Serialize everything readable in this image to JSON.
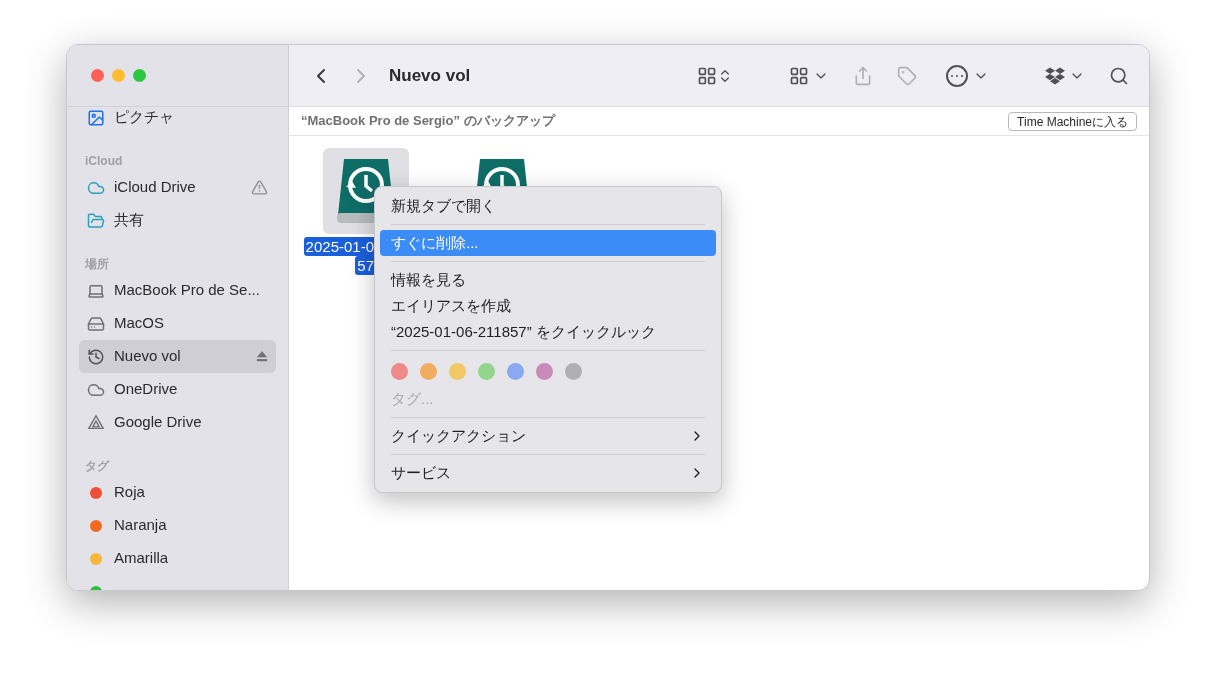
{
  "toolbar": {
    "title": "Nuevo vol",
    "back_disabled": false,
    "forward_disabled": true
  },
  "sidebar": {
    "sections": [
      {
        "items": [
          {
            "label": "ピクチャ",
            "kind": "pictures",
            "selected": false
          }
        ]
      },
      {
        "header": "iCloud",
        "items": [
          {
            "label": "iCloud Drive",
            "kind": "cloud",
            "selected": false,
            "warning": true
          },
          {
            "label": "共有",
            "kind": "shared",
            "selected": false
          }
        ]
      },
      {
        "header": "場所",
        "items": [
          {
            "label": "MacBook Pro de Se...",
            "kind": "laptop",
            "selected": false
          },
          {
            "label": "MacOS",
            "kind": "drive",
            "selected": false
          },
          {
            "label": "Nuevo vol",
            "kind": "volume",
            "selected": true,
            "eject": true
          },
          {
            "label": "OneDrive",
            "kind": "onedrive",
            "selected": false
          },
          {
            "label": "Google Drive",
            "kind": "gdrive",
            "selected": false
          }
        ]
      },
      {
        "header": "タグ",
        "items": [
          {
            "label": "Roja",
            "kind": "tag",
            "color": "#f04e37",
            "selected": false
          },
          {
            "label": "Naranja",
            "kind": "tag",
            "color": "#f26b21",
            "selected": false
          },
          {
            "label": "Amarilla",
            "kind": "tag",
            "color": "#f6b73c",
            "selected": false
          },
          {
            "kind": "tag",
            "color": "#2ac140",
            "selected": false
          }
        ]
      }
    ]
  },
  "path_bar": {
    "text": "“MacBook Pro de Sergio” のバックアップ",
    "button": "Time Machineに入る"
  },
  "files": [
    {
      "name_lines": [
        "2025-01-0",
        "57"
      ],
      "selected": true
    },
    {
      "selected": false
    }
  ],
  "context_menu": {
    "items": [
      {
        "kind": "item",
        "label": "新規タブで開く",
        "selected": false
      },
      {
        "kind": "separator"
      },
      {
        "kind": "item",
        "label": "すぐに削除...",
        "selected": true
      },
      {
        "kind": "separator"
      },
      {
        "kind": "item",
        "label": "情報を見る",
        "selected": false
      },
      {
        "kind": "item",
        "label": "エイリアスを作成",
        "selected": false
      },
      {
        "kind": "item",
        "label": "“2025-01-06-211857” をクイックルック",
        "selected": false
      },
      {
        "kind": "separator"
      },
      {
        "kind": "colors",
        "tags": [
          {
            "color": "#ee8a88"
          },
          {
            "color": "#f0ad60"
          },
          {
            "color": "#f2c865"
          },
          {
            "color": "#93d48e"
          },
          {
            "color": "#8aa9f0"
          },
          {
            "color": "#c88ab8"
          },
          {
            "color": "#b0b0b3"
          }
        ]
      },
      {
        "kind": "item",
        "label": "タグ...",
        "selected": false,
        "disabled": true
      },
      {
        "kind": "separator"
      },
      {
        "kind": "submenu",
        "label": "クイックアクション",
        "selected": false
      },
      {
        "kind": "separator"
      },
      {
        "kind": "submenu",
        "label": "サービス",
        "selected": false
      }
    ]
  }
}
